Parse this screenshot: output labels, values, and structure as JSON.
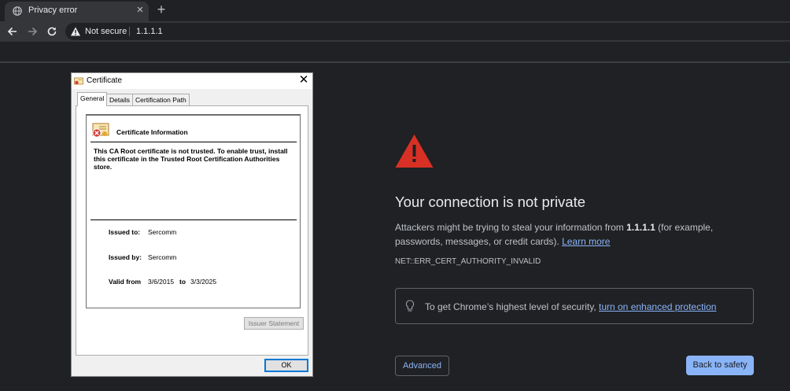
{
  "browser": {
    "tab": {
      "title": "Privacy error",
      "close_glyph": "×",
      "favicon_icon": "globe-icon"
    },
    "new_tab_glyph": "+",
    "toolbar": {
      "back_icon": "back-arrow-icon",
      "forward_icon": "forward-arrow-icon",
      "reload_icon": "reload-icon",
      "security_label": "Not secure",
      "url": "1.1.1.1"
    }
  },
  "interstitial": {
    "heading": "Your connection is not private",
    "body_prefix": "Attackers might be trying to steal your information from ",
    "body_host": "1.1.1.1",
    "body_suffix": " (for example, passwords, messages, or credit cards). ",
    "learn_more": "Learn more",
    "error_code": "NET::ERR_CERT_AUTHORITY_INVALID",
    "enhanced_prefix": "To get Chrome’s highest level of security, ",
    "enhanced_link": "turn on enhanced protection",
    "advanced_label": "Advanced",
    "back_to_safety_label": "Back to safety"
  },
  "colors": {
    "background": "#202124",
    "link": "#8ab4f8",
    "warning_red": "#d93025"
  },
  "certificate_dialog": {
    "title": "Certificate",
    "close_glyph": "✕",
    "tabs": [
      "General",
      "Details",
      "Certification Path"
    ],
    "info_title": "Certificate Information",
    "warning": "This CA Root certificate is not trusted. To enable trust, install this certificate in the Trusted Root Certification Authorities store.",
    "issued_to_label": "Issued to:",
    "issued_to_value": "Sercomm",
    "issued_by_label": "Issued by:",
    "issued_by_value": "Sercomm",
    "valid_from_label": "Valid from",
    "valid_from_value": "3/6/2015",
    "valid_to_label": "to",
    "valid_to_value": "3/3/2025",
    "issuer_statement_label": "Issuer Statement",
    "ok_label": "OK"
  }
}
